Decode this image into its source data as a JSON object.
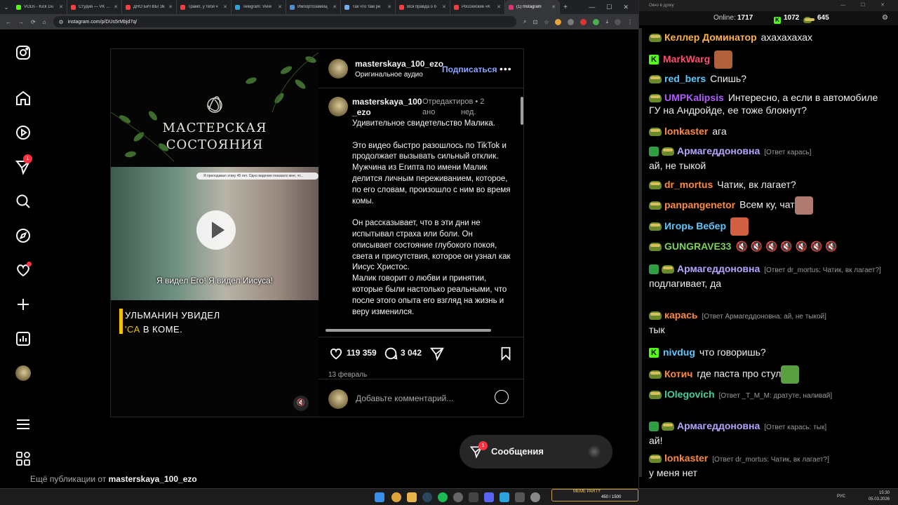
{
  "browser": {
    "tabs": [
      {
        "title": "VODs - Kick Du",
        "color": "#53fc18"
      },
      {
        "title": "Студия — VK Видео",
        "color": "#ff3b3b"
      },
      {
        "title": "ДНО БИТВЫ Эк",
        "color": "#ff3b3b"
      },
      {
        "title": "Трамп, у тебя ч",
        "color": "#ff3b3b"
      },
      {
        "title": "Telegram: View",
        "color": "#2aa3df"
      },
      {
        "title": "Импортозамещ",
        "color": "#4a90d9"
      },
      {
        "title": "Так что там ре",
        "color": "#6ab0f3"
      },
      {
        "title": "Вся правда о б",
        "color": "#ff3b3b"
      },
      {
        "title": "Российские «К",
        "color": "#ff3b3b"
      },
      {
        "title": "(1) Instagram",
        "color": "#e1306c",
        "active": true
      }
    ],
    "url": "instagram.com/p/DUs5rMbjd7q/"
  },
  "post": {
    "logo_line1": "МАСТЕРСКАЯ",
    "logo_line2": "СОСТОЯНИЯ",
    "video_banner": "Я преподавал этику 45 лет. Одно видение показало мне, чт...",
    "video_caption": "Я видел Его! Я видел Иисуса!",
    "subtitle_line1": "УЛЬМАНИН УВИДЕЛ",
    "subtitle_line2_accent": "'СА",
    "subtitle_line2_rest": " В КОМЕ.",
    "handle": "masterskaya_100_ezo",
    "audio": "Оригинальное аудио",
    "follow_label": "Подписаться",
    "more_label": "•••",
    "caption_author_line1": "masterskaya_100",
    "caption_author_line2": "_ezo",
    "caption_meta_line1": "Отредактиров • 2",
    "caption_meta_line2": "ано            нед.",
    "caption_paragraphs": [
      "Удивительное свидетельство Малика.",
      "Это видео быстро разошлось по TikTok и продолжает вызывать сильный отклик.\nМужчина из Египта по имени Малик делится личным переживанием, которое, по его словам, произошло с ним во время комы.",
      "Он рассказывает, что в эти дни не испытывал страха или боли. Он описывает состояние глубокого покоя, света и присутствия, которое он узнал как Иисус Христос.\nМалик говорит о любви и принятии, которые были настолько реальными, что после этого опыта его взгляд на жизнь и веру изменился."
    ],
    "likes": "119 359",
    "comments": "3 042",
    "date": "13 февраль",
    "comment_placeholder": "Добавьте комментарий..."
  },
  "rail": {
    "notifications_badge": "1"
  },
  "more_posts_prefix": "Ещё публикации от ",
  "more_posts_handle": "masterskaya_100_ezo",
  "messages": {
    "label": "Сообщения",
    "badge": "1"
  },
  "chat": {
    "window_title": "Окно в духку",
    "online_label": "Online:",
    "online_count": "1717",
    "kick_count": "1072",
    "other_count": "645",
    "messages": [
      {
        "nick": "Келлер Доминатор",
        "color": "#ffb347",
        "text": "ахахахахах",
        "icon": "pepe"
      },
      {
        "nick": "MarkWarg",
        "color": "#ff4d6d",
        "text": "",
        "icon": "kick",
        "emote": "#b0603a"
      },
      {
        "nick": "red_bers",
        "color": "#5cc8ff",
        "text": "Спишь?",
        "icon": "pepe"
      },
      {
        "nick": "UMPKalipsis",
        "color": "#b25cff",
        "text": "Интересно, а если в автомобиле ГУ на Андройде, ее тоже блокнут?",
        "icon": "pepe"
      },
      {
        "nick": "lonkaster",
        "color": "#ff8a3d",
        "text": "ага",
        "icon": "pepe"
      },
      {
        "nick": "Армагеддоновна",
        "color": "#b9a4ff",
        "reply": "[Ответ карась]",
        "text": "ай, не тыкой",
        "icon": "mod"
      },
      {
        "nick": "dr_mortus",
        "color": "#ff8a3d",
        "text": "Чатик, вк лагает?",
        "icon": "pepe"
      },
      {
        "nick": "panpangenetor",
        "color": "#ff8a3d",
        "text": "Всем ку, чат",
        "icon": "pepe",
        "emote": "#b07a70"
      },
      {
        "nick": "Игорь Вебер",
        "color": "#5cc8ff",
        "text": "",
        "icon": "pepe",
        "emote": "#d06040"
      },
      {
        "nick": "GUNGRAVE33",
        "color": "#7cd35a",
        "text": "🔇 🔇 🔇 🔇 🔇 🔇 🔇",
        "icon": "pepe"
      },
      {
        "nick": "Армагеддоновна",
        "color": "#b9a4ff",
        "reply": "[Ответ dr_mortus: Чатик, вк лагает?]",
        "text": "подлагивает, да",
        "icon": "mod"
      },
      {
        "nick": "карась",
        "color": "#ff8a3d",
        "reply": "[Ответ Армагеддоновна: ай, не тыкой]",
        "text": "тык",
        "icon": "pepe"
      },
      {
        "nick": "nivdug",
        "color": "#5cc8ff",
        "text": "что говоришь?",
        "icon": "kick"
      },
      {
        "nick": "Котич",
        "color": "#ff8a3d",
        "text": "где паста про стул",
        "icon": "pepe",
        "emote": "#5aa040"
      },
      {
        "nick": "lOlegovich",
        "color": "#3dd0a0",
        "reply": "[Ответ _T_M_M: дратуте, наливай]",
        "text": "",
        "icon": "pepe"
      },
      {
        "nick": "Армагеддоновна",
        "color": "#b9a4ff",
        "reply": "[Ответ карась: тык]",
        "text": "ай!",
        "icon": "mod"
      },
      {
        "nick": "lonkaster",
        "color": "#ff8a3d",
        "reply": "[Ответ dr_mortus: Чатик, вк лагает?]",
        "text": "у меня нет",
        "icon": "pepe"
      }
    ]
  },
  "taskbar": {
    "lang": "РУС",
    "time": "15:30",
    "date": "05.03.2026",
    "meme_title": "MEME PARTY",
    "meme_counter": "450 / 1500"
  }
}
